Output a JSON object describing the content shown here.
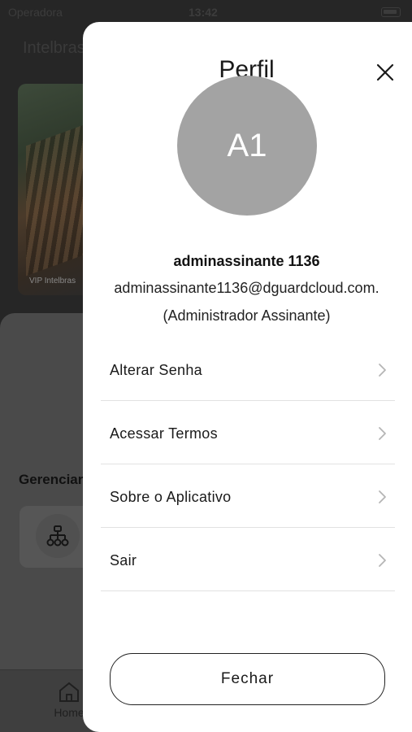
{
  "status_bar": {
    "carrier": "Operadora",
    "time": "13:42"
  },
  "background": {
    "app_title": "Intelbras",
    "camera_label": "VIP Intelbras",
    "section_title": "Gerenciar",
    "home_tab_label": "Home"
  },
  "profile": {
    "title": "Perfil",
    "avatar_initials": "A1",
    "name": "adminassinante 1136",
    "email": "adminassinante1136@dguardcloud.com.",
    "role": "(Administrador Assinante)",
    "menu_items": [
      {
        "label": "Alterar Senha"
      },
      {
        "label": "Acessar Termos"
      },
      {
        "label": "Sobre o Aplicativo"
      },
      {
        "label": "Sair"
      }
    ],
    "close_button_label": "Fechar",
    "colors": {
      "avatar_bg": "#a3a3a3",
      "divider": "#e2e2e2",
      "chevron": "#b5b5b5"
    }
  }
}
